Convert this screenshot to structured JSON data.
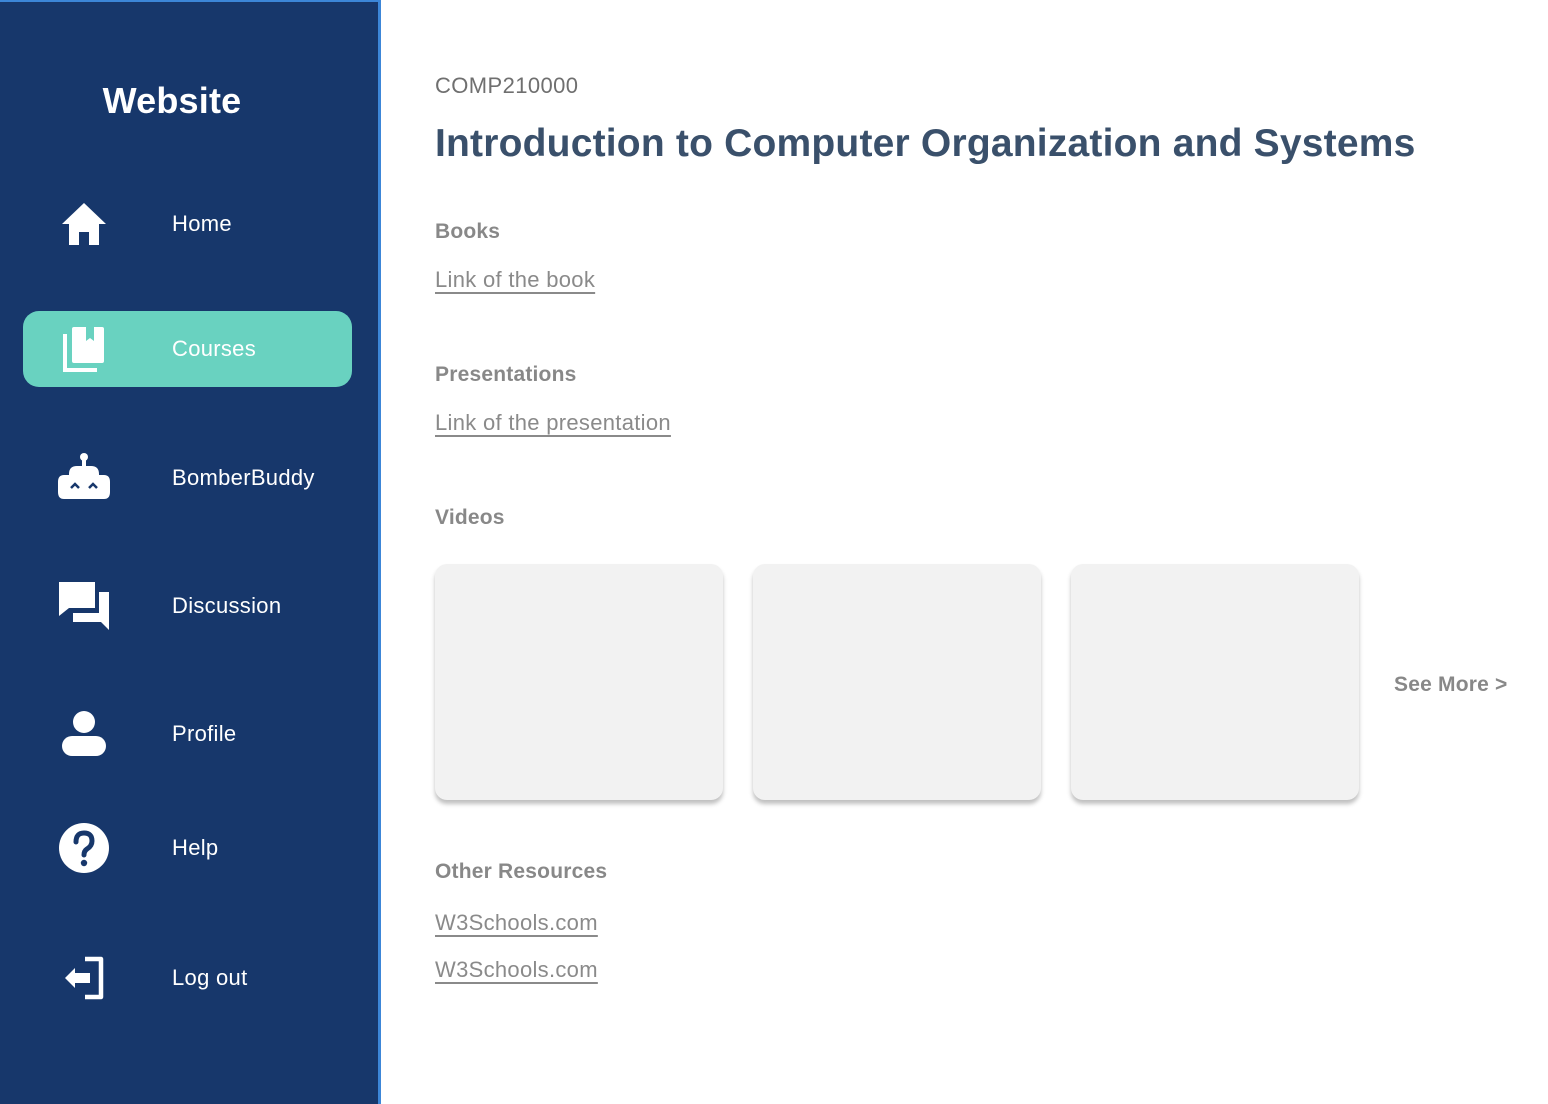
{
  "sidebar": {
    "brand": "Website",
    "items": [
      {
        "label": "Home",
        "icon": "home-icon",
        "active": false
      },
      {
        "label": "Courses",
        "icon": "courses-icon",
        "active": true
      },
      {
        "label": "BomberBuddy",
        "icon": "robot-icon",
        "active": false
      },
      {
        "label": "Discussion",
        "icon": "discussion-icon",
        "active": false
      },
      {
        "label": "Profile",
        "icon": "profile-icon",
        "active": false
      },
      {
        "label": "Help",
        "icon": "help-icon",
        "active": false
      },
      {
        "label": "Log out",
        "icon": "logout-icon",
        "active": false
      }
    ]
  },
  "course": {
    "code": "COMP210000",
    "title": "Introduction to Computer Organization and Systems"
  },
  "sections": {
    "books": {
      "heading": "Books",
      "link": "Link of the book"
    },
    "presentations": {
      "heading": "Presentations",
      "link": "Link of the presentation"
    },
    "videos": {
      "heading": "Videos",
      "see_more": "See More >"
    },
    "other": {
      "heading": "Other Resources",
      "links": [
        "W3Schools.com",
        "W3Schools.com"
      ]
    }
  },
  "colors": {
    "sidebar_bg": "#17376b",
    "sidebar_border": "#3c86d8",
    "active_item": "#69d2c0",
    "title": "#3a506b",
    "muted_text": "#888888",
    "video_placeholder": "#f2f2f2"
  }
}
